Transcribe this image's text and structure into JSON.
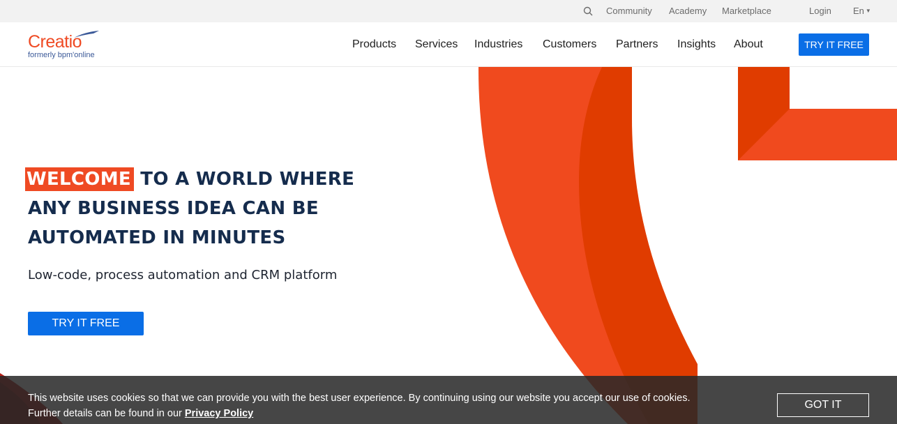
{
  "utility_bar": {
    "community": "Community",
    "academy": "Academy",
    "marketplace": "Marketplace",
    "login": "Login",
    "language": "En",
    "search_icon": "search-icon"
  },
  "logo": {
    "wordmark": "Creatio",
    "tagline": "formerly bpm'online"
  },
  "nav": {
    "items": [
      "Products",
      "Services",
      "Industries",
      "Customers",
      "Partners",
      "Insights",
      "About"
    ],
    "cta": "TRY IT FREE"
  },
  "hero": {
    "highlight": "WELCOME",
    "title_line1_rest": "TO A WORLD WHERE",
    "title_line2": "ANY BUSINESS IDEA CAN BE",
    "title_line3": "AUTOMATED IN MINUTES",
    "subtitle": "Low-code, process automation and CRM platform",
    "cta": "TRY IT FREE"
  },
  "cookie": {
    "line1": "This website uses cookies so that we can provide you with the best user experience. By continuing using our website you accept our use of cookies.",
    "line2_prefix": "Further details can be found in our ",
    "link": "Privacy Policy",
    "button": "GOT IT"
  },
  "colors": {
    "brand_orange": "#ef4a23",
    "deep_orange": "#e03c00",
    "brand_blue": "#0a6ee6",
    "heading_navy": "#152c4d"
  }
}
